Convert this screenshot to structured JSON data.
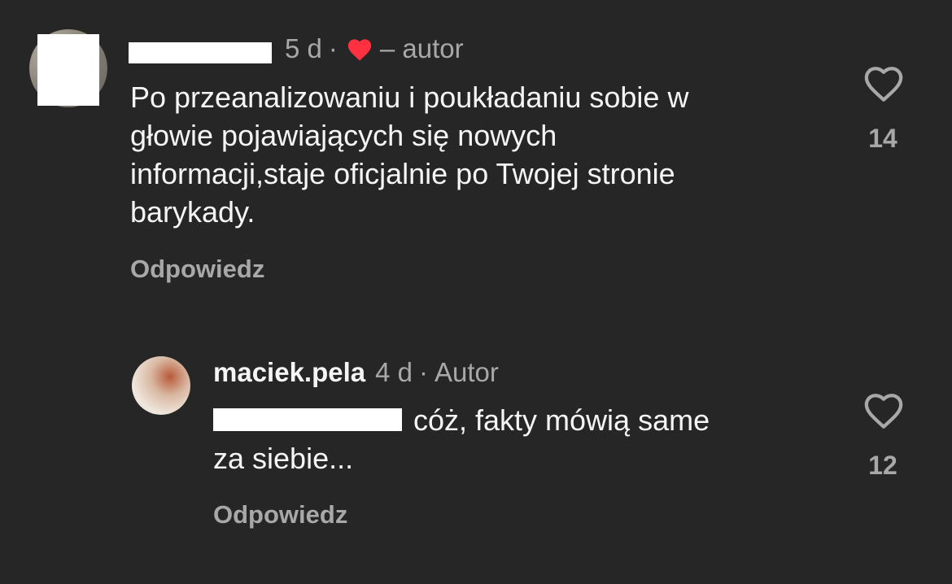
{
  "comments": [
    {
      "time": "5 d",
      "separator": "·",
      "author_tag": "– autor",
      "author_liked": true,
      "text_lines": [
        "Po przeanalizowaniu i poukładaniu sobie w",
        "głowie pojawiających się nowych",
        "informacji,staje oficjalnie po Twojej stronie",
        "barykady."
      ],
      "reply_label": "Odpowiedz",
      "like_count": "14"
    },
    {
      "username": "maciek.pela",
      "time": "4 d",
      "separator": "·",
      "author_tag": "Autor",
      "text_lines": [
        "cóż, fakty mówią same",
        "za siebie..."
      ],
      "reply_label": "Odpowiedz",
      "like_count": "12"
    }
  ],
  "colors": {
    "background": "#262626",
    "primary_text": "#f5f5f5",
    "secondary_text": "#a8a8a8",
    "like_heart": "#ff3040"
  },
  "icons": {
    "creator_like": "filled-heart-icon",
    "like_button": "heart-outline-icon"
  }
}
